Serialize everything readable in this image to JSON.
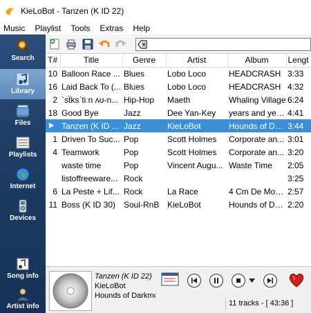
{
  "window": {
    "title": "KieLoBot - Tanzen (K ID 22)"
  },
  "menu": [
    "Music",
    "Playlist",
    "Tools",
    "Extras",
    "Help"
  ],
  "sidebar": {
    "items": [
      {
        "label": "Search",
        "icon": "search-icon"
      },
      {
        "label": "Library",
        "icon": "music-note-icon",
        "active": true
      },
      {
        "label": "Files",
        "icon": "files-icon"
      },
      {
        "label": "Playlists",
        "icon": "playlist-icon"
      },
      {
        "label": "Internet",
        "icon": "globe-icon"
      },
      {
        "label": "Devices",
        "icon": "device-icon"
      },
      {
        "label": "Song info",
        "icon": "song-info-icon"
      },
      {
        "label": "Artist info",
        "icon": "artist-info-icon"
      }
    ]
  },
  "table": {
    "headers": [
      "T#",
      "Title",
      "Genre",
      "Artist",
      "Album",
      "Lengt"
    ],
    "rows": [
      {
        "n": "10",
        "title": "Balloon Race ...",
        "genre": "Blues",
        "artist": "Lobo Loco",
        "album": "HEADCRASH",
        "len": "3:33"
      },
      {
        "n": "16",
        "title": "Laid Back To (...",
        "genre": "Blues",
        "artist": "Lobo Loco",
        "album": "HEADCRASH",
        "len": "4:32"
      },
      {
        "n": "2",
        "title": "`sẗksˊtiːn ʌʊ-n...",
        "genre": "Hip-Hop",
        "artist": "Maeth",
        "album": "Whaling Village",
        "len": "6:24"
      },
      {
        "n": "18",
        "title": "Good Bye",
        "genre": "Jazz",
        "artist": "Dee Yan-Key",
        "album": "years and yea...",
        "len": "4:41"
      },
      {
        "n": "",
        "title": "Tanzen (K ID ...",
        "genre": "Jazz",
        "artist": "KieLoBot",
        "album": "Hounds of Da...",
        "len": "3:44",
        "selected": true,
        "playing": true
      },
      {
        "n": "1",
        "title": "Driven To Suc...",
        "genre": "Pop",
        "artist": "Scott Holmes",
        "album": "Corporate an...",
        "len": "3:01"
      },
      {
        "n": "4",
        "title": "Teamwork",
        "genre": "Pop",
        "artist": "Scott Holmes",
        "album": "Corporate an...",
        "len": "3:20"
      },
      {
        "n": "",
        "title": "waste time",
        "genre": "Pop",
        "artist": "Vincent Augu...",
        "album": "Waste Time",
        "len": "2:05"
      },
      {
        "n": "",
        "title": "listoffreeware...",
        "genre": "Rock",
        "artist": "",
        "album": "",
        "len": "3:25"
      },
      {
        "n": "6",
        "title": "La Peste + Lif...",
        "genre": "Rock",
        "artist": "La Race",
        "album": "4 Cm De Mon...",
        "len": "2:57"
      },
      {
        "n": "11",
        "title": "Boss (K ID 30)",
        "genre": "Soul-RnB",
        "artist": "KieLoBot",
        "album": "Hounds of Da...",
        "len": "2:20"
      }
    ]
  },
  "now_playing": {
    "title": "Tanzen (K ID 22)",
    "artist": "KieLoBot",
    "album": "Hounds of Darkmc"
  },
  "status": "11 tracks - [ 43:36 ]",
  "colors": {
    "sidebar": "#1f3e66",
    "selection": "#3b8fd6",
    "heart": "#d0201f"
  }
}
